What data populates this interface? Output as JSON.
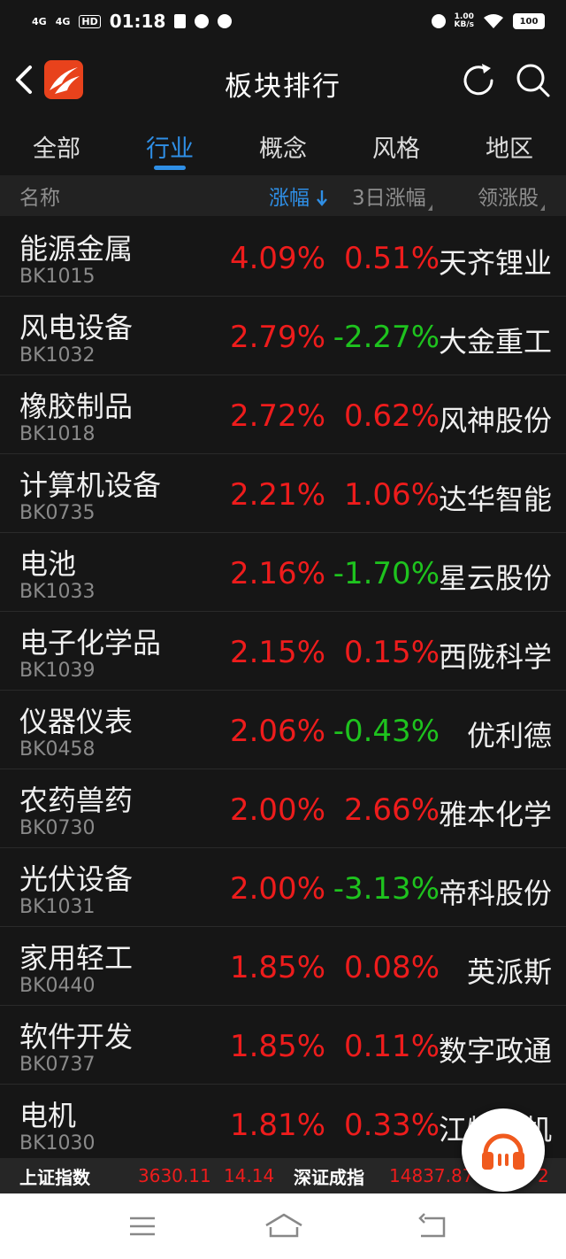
{
  "status_bar": {
    "signal1": "4G",
    "signal2": "4G",
    "hd": "HD",
    "time": "01:18",
    "speed_value": "1.00",
    "speed_unit": "KB/s",
    "battery": "100"
  },
  "header": {
    "title": "板块排行"
  },
  "tabs": [
    {
      "label": "全部",
      "active": false
    },
    {
      "label": "行业",
      "active": true
    },
    {
      "label": "概念",
      "active": false
    },
    {
      "label": "风格",
      "active": false
    },
    {
      "label": "地区",
      "active": false
    }
  ],
  "columns": {
    "name": "名称",
    "change": "涨幅",
    "change_3d": "3日涨幅",
    "leader": "领涨股"
  },
  "rows": [
    {
      "name": "能源金属",
      "code": "BK1015",
      "change": "4.09%",
      "change_3d": "0.51%",
      "leader": "天齐锂业"
    },
    {
      "name": "风电设备",
      "code": "BK1032",
      "change": "2.79%",
      "change_3d": "-2.27%",
      "leader": "大金重工"
    },
    {
      "name": "橡胶制品",
      "code": "BK1018",
      "change": "2.72%",
      "change_3d": "0.62%",
      "leader": "风神股份"
    },
    {
      "name": "计算机设备",
      "code": "BK0735",
      "change": "2.21%",
      "change_3d": "1.06%",
      "leader": "达华智能"
    },
    {
      "name": "电池",
      "code": "BK1033",
      "change": "2.16%",
      "change_3d": "-1.70%",
      "leader": "星云股份"
    },
    {
      "name": "电子化学品",
      "code": "BK1039",
      "change": "2.15%",
      "change_3d": "0.15%",
      "leader": "西陇科学"
    },
    {
      "name": "仪器仪表",
      "code": "BK0458",
      "change": "2.06%",
      "change_3d": "-0.43%",
      "leader": "优利德"
    },
    {
      "name": "农药兽药",
      "code": "BK0730",
      "change": "2.00%",
      "change_3d": "2.66%",
      "leader": "雅本化学"
    },
    {
      "name": "光伏设备",
      "code": "BK1031",
      "change": "2.00%",
      "change_3d": "-3.13%",
      "leader": "帝科股份"
    },
    {
      "name": "家用轻工",
      "code": "BK0440",
      "change": "1.85%",
      "change_3d": "0.08%",
      "leader": "英派斯"
    },
    {
      "name": "软件开发",
      "code": "BK0737",
      "change": "1.85%",
      "change_3d": "0.11%",
      "leader": "数字政通"
    },
    {
      "name": "电机",
      "code": "BK1030",
      "change": "1.81%",
      "change_3d": "0.33%",
      "leader": "江特电机"
    }
  ],
  "ticker": {
    "sh_name": "上证指数",
    "sh_value": "3630.11",
    "sh_change": "14.14",
    "sz_name": "深证成指",
    "sz_value": "14837.87",
    "sz_change": "2"
  },
  "colors": {
    "up": "#ee1c1c",
    "down": "#1ec31e",
    "accent": "#2f8fe6",
    "background": "#161616"
  }
}
